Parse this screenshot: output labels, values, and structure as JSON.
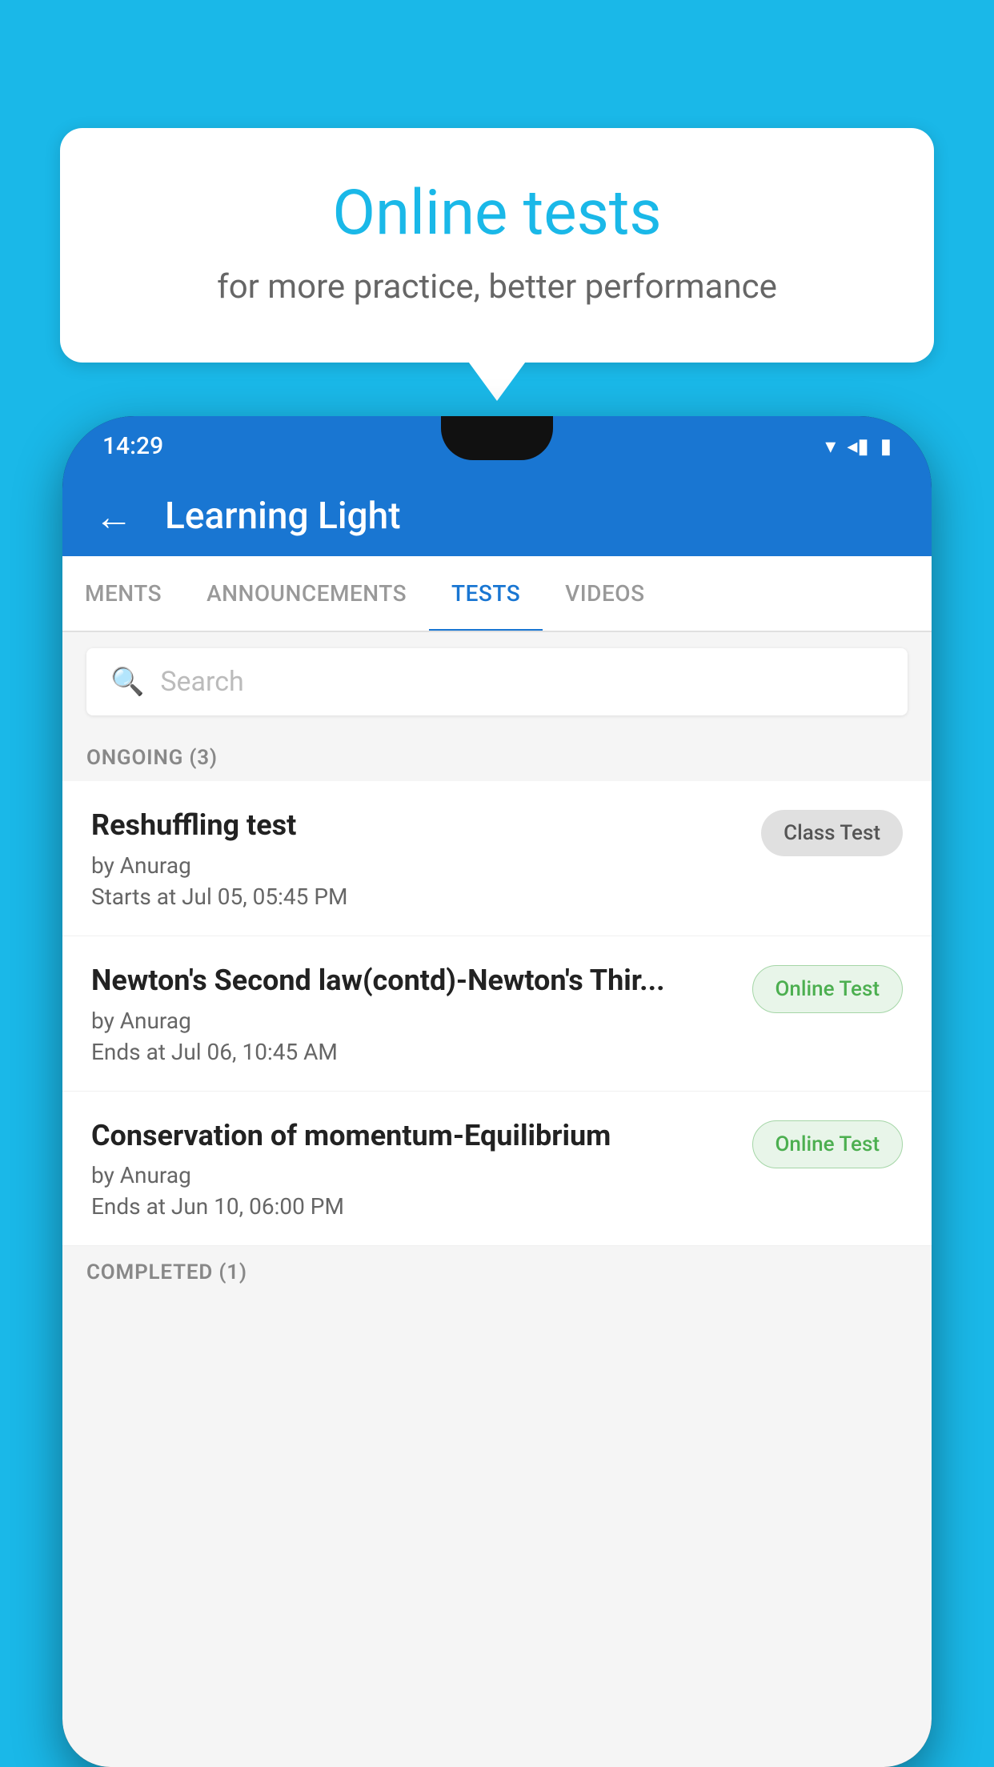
{
  "background_color": "#1ab8e8",
  "speech_bubble": {
    "title": "Online tests",
    "subtitle": "for more practice, better performance"
  },
  "status_bar": {
    "time": "14:29",
    "icons": [
      "▾",
      "◂",
      "▮"
    ]
  },
  "app_bar": {
    "title": "Learning Light",
    "back_label": "←"
  },
  "tabs": [
    {
      "label": "MENTS",
      "active": false
    },
    {
      "label": "ANNOUNCEMENTS",
      "active": false
    },
    {
      "label": "TESTS",
      "active": true
    },
    {
      "label": "VIDEOS",
      "active": false
    }
  ],
  "search": {
    "placeholder": "Search"
  },
  "ongoing_section": {
    "label": "ONGOING (3)"
  },
  "tests": [
    {
      "title": "Reshuffling test",
      "author": "by Anurag",
      "date": "Starts at  Jul 05, 05:45 PM",
      "badge": "Class Test",
      "badge_type": "class"
    },
    {
      "title": "Newton's Second law(contd)-Newton's Thir...",
      "author": "by Anurag",
      "date": "Ends at  Jul 06, 10:45 AM",
      "badge": "Online Test",
      "badge_type": "online"
    },
    {
      "title": "Conservation of momentum-Equilibrium",
      "author": "by Anurag",
      "date": "Ends at  Jun 10, 06:00 PM",
      "badge": "Online Test",
      "badge_type": "online"
    }
  ],
  "completed_section": {
    "label": "COMPLETED (1)"
  },
  "icons": {
    "search": "🔍",
    "back": "←",
    "wifi": "▾",
    "signal": "◂",
    "battery": "▮"
  }
}
